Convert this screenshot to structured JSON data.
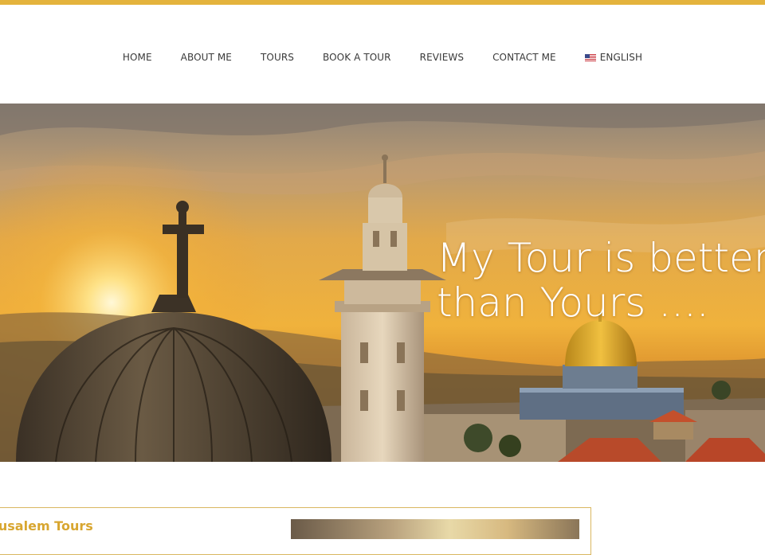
{
  "nav": {
    "items": [
      {
        "label": "HOME"
      },
      {
        "label": "ABOUT ME"
      },
      {
        "label": "TOURS"
      },
      {
        "label": "BOOK A TOUR"
      },
      {
        "label": "REVIEWS"
      },
      {
        "label": "CONTACT ME"
      }
    ],
    "language": {
      "label": "ENGLISH",
      "icon": "us-flag-icon"
    }
  },
  "hero": {
    "headline_line1": "My Tour is better",
    "headline_line2": "than Yours ...."
  },
  "section": {
    "card_title": "rusalem Tours"
  },
  "colors": {
    "accent": "#e4b33d",
    "card_title": "#d8a630",
    "card_border": "#d9b760",
    "nav_text": "#3a3a3a"
  }
}
